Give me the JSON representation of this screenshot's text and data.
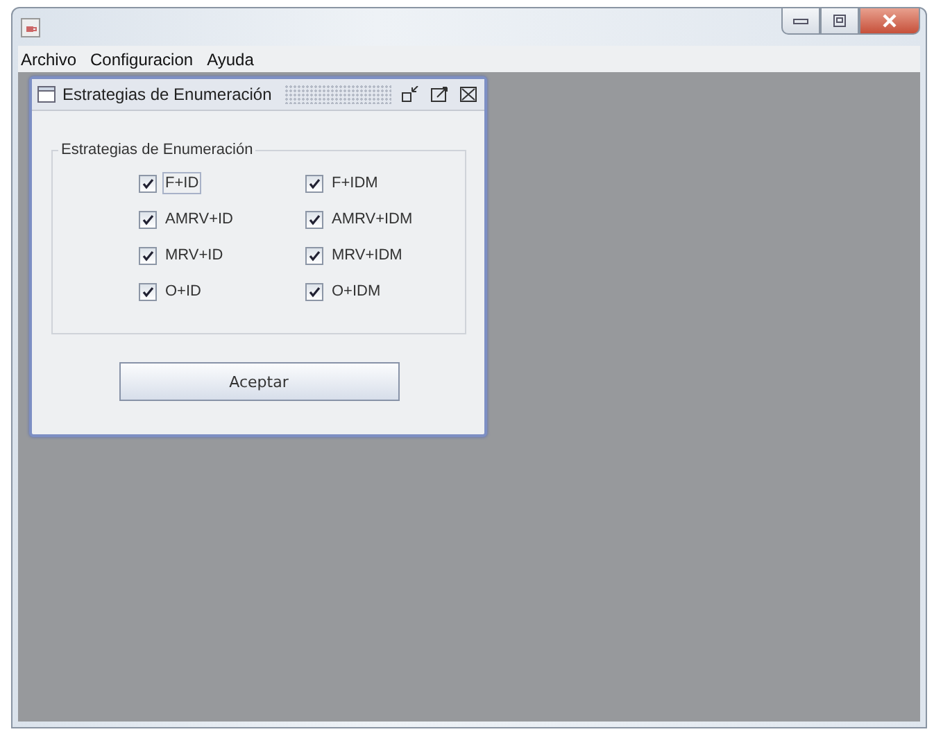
{
  "menu_bar": [
    "Archivo",
    "Configuracion",
    "Ayuda"
  ],
  "internal_frame": {
    "title": "Estrategias de Enumeración",
    "group": {
      "title": "Estrategias de Enumeración",
      "checkboxes": [
        {
          "label": "F+ID",
          "checked": true,
          "focused": true
        },
        {
          "label": "F+IDM",
          "checked": true,
          "focused": false
        },
        {
          "label": "AMRV+ID",
          "checked": true,
          "focused": false
        },
        {
          "label": "AMRV+IDM",
          "checked": true,
          "focused": false
        },
        {
          "label": "MRV+ID",
          "checked": true,
          "focused": false
        },
        {
          "label": "MRV+IDM",
          "checked": true,
          "focused": false
        },
        {
          "label": "O+ID",
          "checked": true,
          "focused": false
        },
        {
          "label": "O+IDM",
          "checked": true,
          "focused": false
        }
      ]
    },
    "button": "Aceptar"
  }
}
